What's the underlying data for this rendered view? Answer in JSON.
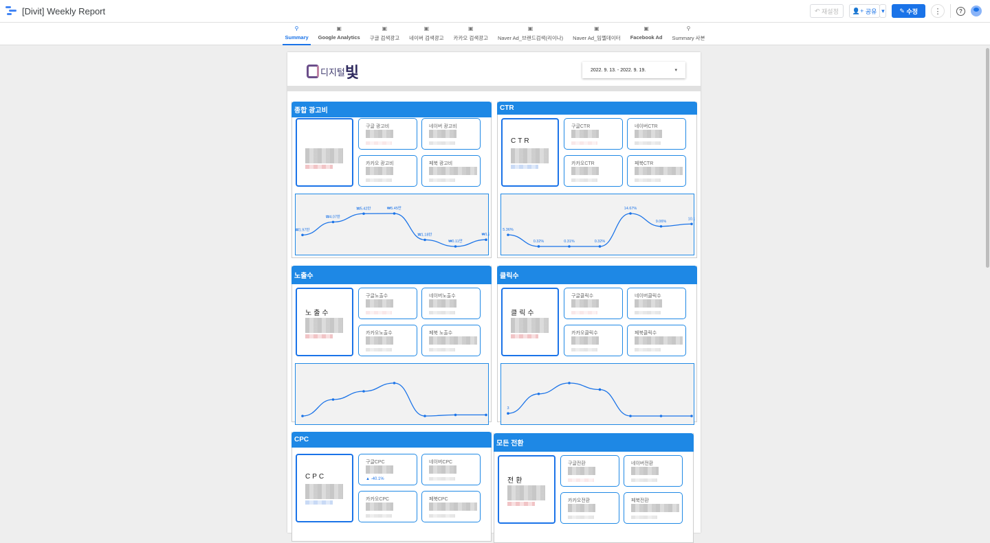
{
  "header": {
    "title": "[Divit] Weekly Report",
    "reset_label": "재설정",
    "share_label": "공유",
    "edit_label": "수정",
    "more_icon": "more-vert-icon",
    "help_icon": "help-icon"
  },
  "tabs": [
    {
      "label": "Summary",
      "icon": "pin",
      "active": true
    },
    {
      "label": "Google Analytics",
      "icon": "page"
    },
    {
      "label": "구글 검색광고",
      "icon": "page"
    },
    {
      "label": "네이버 검색광고",
      "icon": "page"
    },
    {
      "label": "카카오 검색광고",
      "icon": "page"
    },
    {
      "label": "Naver Ad_브랜드검색(리이나)",
      "icon": "page"
    },
    {
      "label": "Naver Ad_임멜데이터",
      "icon": "page"
    },
    {
      "label": "Facebook Ad",
      "icon": "page"
    },
    {
      "label": "Summary 사본",
      "icon": "pin"
    }
  ],
  "report": {
    "logo_text": "디지털",
    "logo_big": "빛",
    "date_range": "2022. 9. 13. - 2022. 9. 19.",
    "date_caret": "▾"
  },
  "panels": [
    {
      "title": "종합 광고비",
      "kpi_label": "",
      "cards": [
        "구글 광고비",
        "네이버 광고비",
        "카카오 광고비",
        "페북 광고비"
      ],
      "delta": ""
    },
    {
      "title": "CTR",
      "kpi_label": "CTR",
      "cards": [
        "구글CTR",
        "네이버CTR",
        "카카오CTR",
        "페북CTR"
      ],
      "delta": ""
    },
    {
      "title": "노출수",
      "kpi_label": "노출수",
      "cards": [
        "구글노출수",
        "네이버노출수",
        "카카오노출수",
        "페북 노출수"
      ],
      "delta": ""
    },
    {
      "title": "클릭수",
      "kpi_label": "클릭수",
      "cards": [
        "구글클릭수",
        "네이버클릭수",
        "카카오클릭수",
        "페북클릭수"
      ],
      "delta": ""
    },
    {
      "title": "CPC",
      "kpi_label": "CPC",
      "cards": [
        "구글CPC",
        "네이버CPC",
        "카카오CPC",
        "페북CPC"
      ],
      "delta": "▲ -40.1%"
    },
    {
      "title": "모든 전환",
      "kpi_label": "전환",
      "cards": [
        "구글전환",
        "네이버전환",
        "카카오전환",
        "페북전환"
      ],
      "delta": ""
    }
  ],
  "chart_data": [
    {
      "type": "line",
      "title": "종합 광고비 추이",
      "values": [
        1.97,
        4.07,
        5.42,
        5.45,
        1.18,
        0.11,
        1.2
      ],
      "labels": [
        "₩1.97만",
        "₩4.07만",
        "₩5.42만",
        "₩5.45만",
        "₩1.18만",
        "₩0.11만",
        "₩1.2"
      ]
    },
    {
      "type": "line",
      "title": "CTR 추이",
      "values": [
        5.36,
        0.32,
        0.31,
        0.32,
        14.67,
        9.06,
        10.1
      ],
      "labels": [
        "5.36%",
        "0.32%",
        "0.31%",
        "0.32%",
        "14.67%",
        "9.06%",
        "10.1"
      ]
    },
    {
      "type": "line",
      "title": "노출수 추이",
      "values": [
        1,
        4,
        5.5,
        7,
        1,
        1.2,
        1.2
      ],
      "labels": [
        "",
        "",
        "",
        "",
        "",
        "",
        ""
      ]
    },
    {
      "type": "line",
      "title": "클릭수 추이",
      "values": [
        1,
        5.5,
        8,
        6.5,
        0.4,
        0.4,
        0.4
      ],
      "labels": [
        "3",
        "",
        "",
        "",
        "",
        "",
        ""
      ]
    }
  ],
  "colors": {
    "accent": "#1a73e8",
    "panel_header": "#1e88e5",
    "line": "#1a73e8"
  }
}
